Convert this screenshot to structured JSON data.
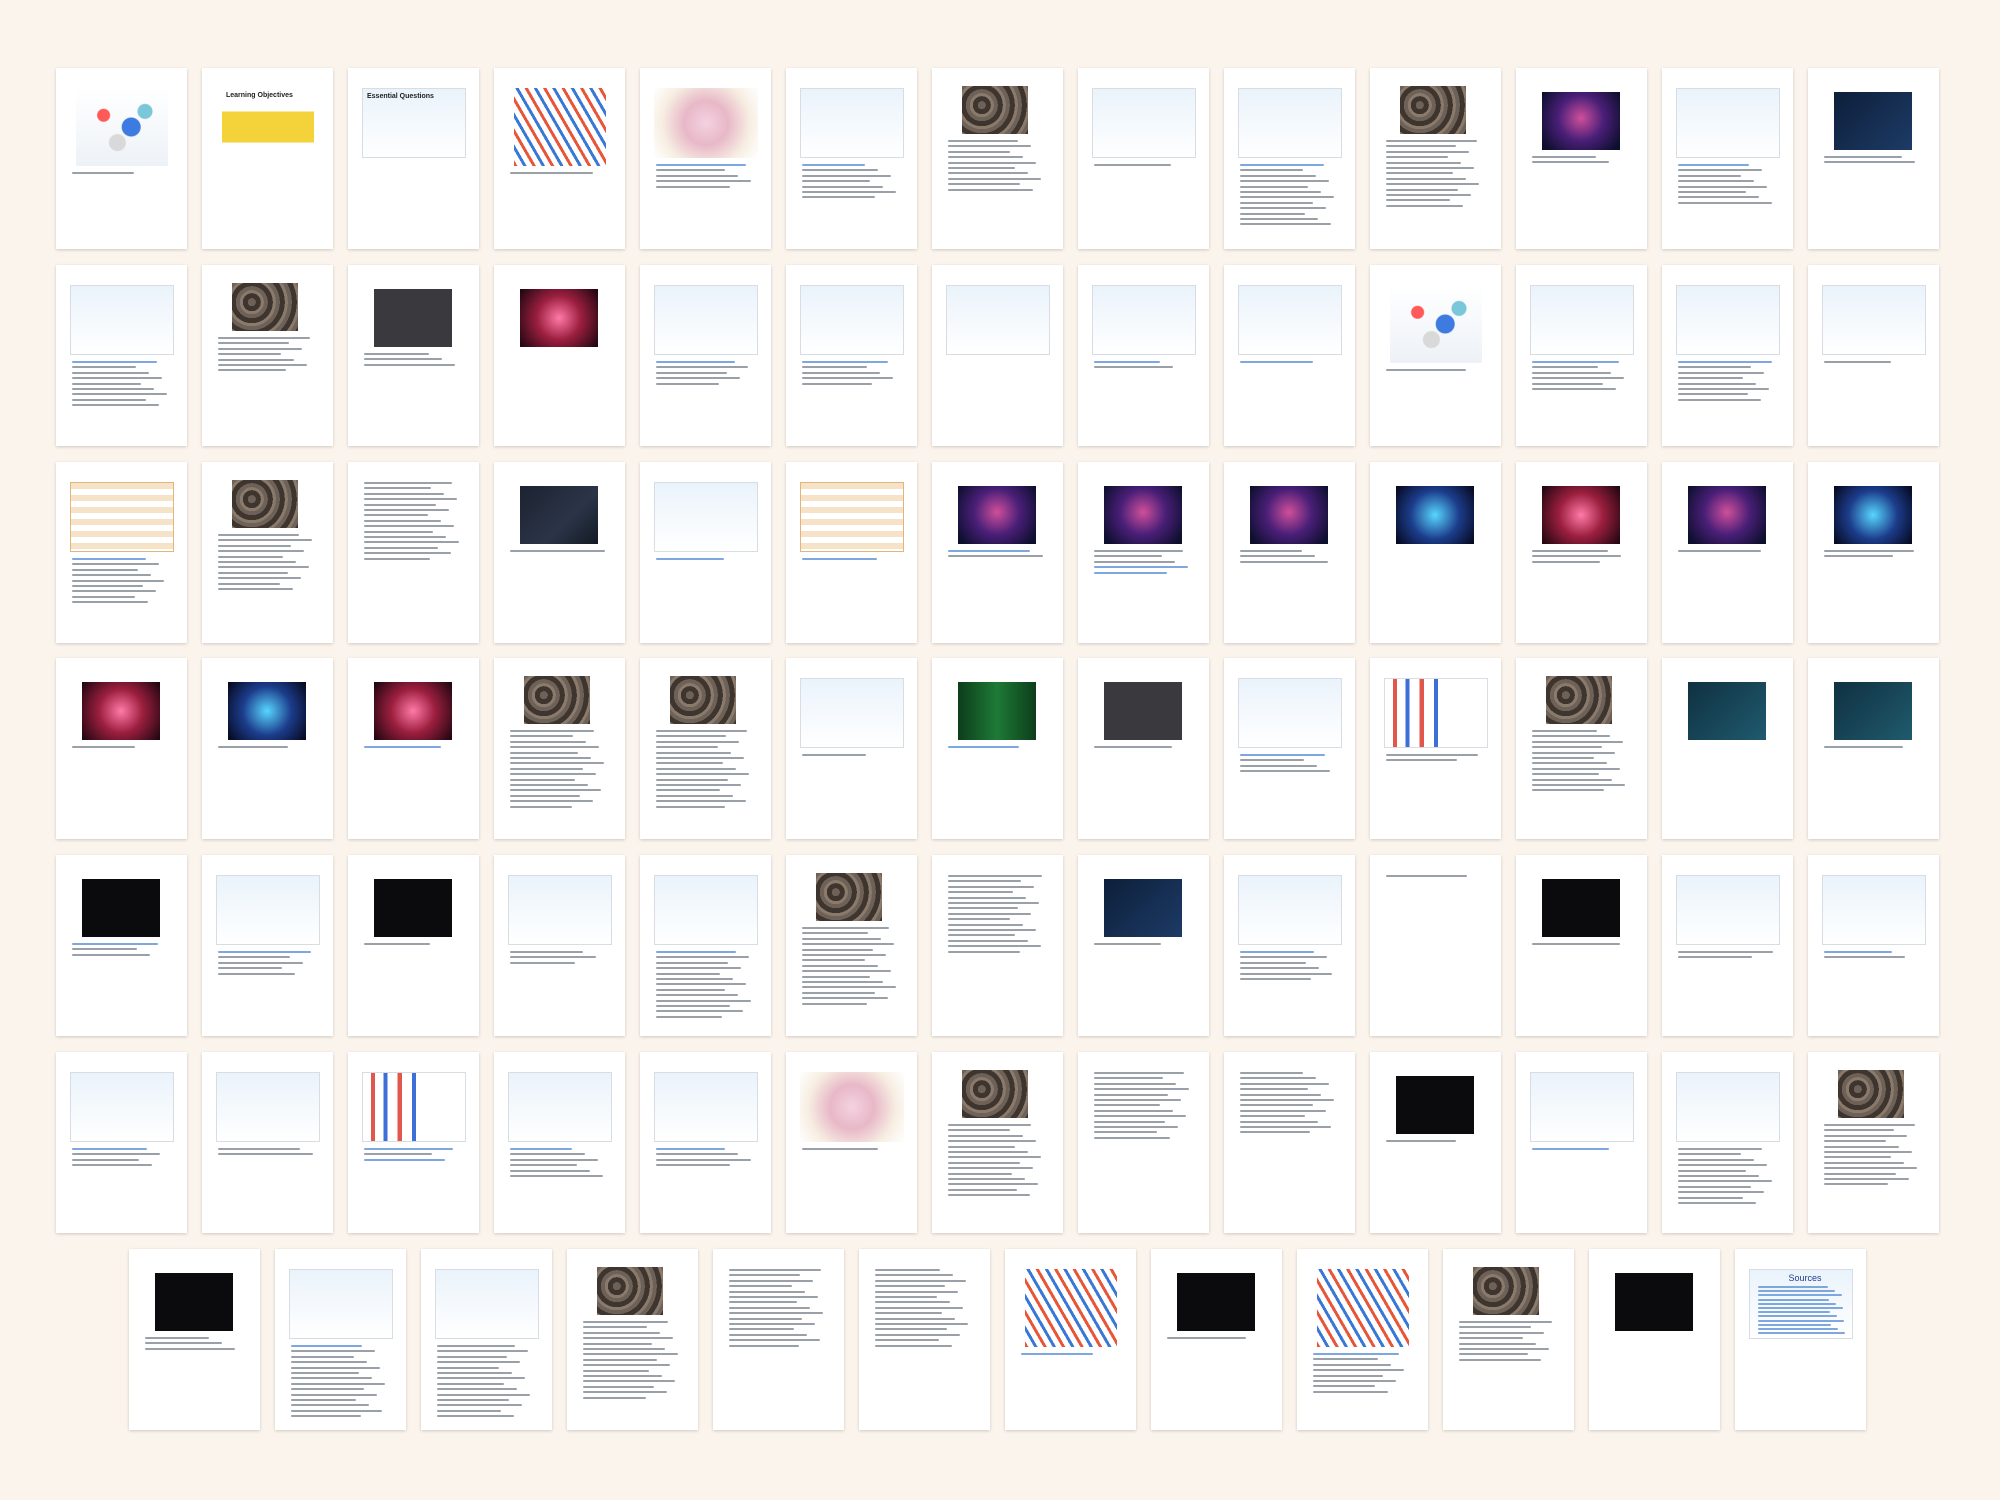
{
  "document": {
    "background_color": "#fbf4ec",
    "pages": [
      {
        "n": 1,
        "kind": "molecule",
        "title": "",
        "lines": [
          "dark"
        ]
      },
      {
        "n": 2,
        "kind": "yellow",
        "title": "Learning Objectives",
        "lines": []
      },
      {
        "n": 3,
        "kind": "light",
        "title": "Essential Questions",
        "lines": []
      },
      {
        "n": 4,
        "kind": "helix",
        "title": "",
        "lines": [
          "dark"
        ]
      },
      {
        "n": 5,
        "kind": "pink",
        "title": "",
        "lines": [
          "blue",
          "dark",
          "dark",
          "dark",
          "dark"
        ]
      },
      {
        "n": 6,
        "kind": "light",
        "title": "",
        "lines": [
          "blue",
          "dark",
          "dark",
          "dark",
          "dark",
          "dark",
          "dark"
        ]
      },
      {
        "n": 7,
        "kind": "rough",
        "title": "",
        "lines": [
          "dark",
          "dark",
          "dark",
          "dark",
          "dark",
          "dark",
          "dark",
          "dark",
          "dark",
          "dark"
        ]
      },
      {
        "n": 8,
        "kind": "light",
        "title": "",
        "lines": [
          "dark"
        ]
      },
      {
        "n": 9,
        "kind": "light",
        "title": "",
        "lines": [
          "blue",
          "dark",
          "dark",
          "dark",
          "dark",
          "dark",
          "dark",
          "dark",
          "dark",
          "dark",
          "dark",
          "dark"
        ]
      },
      {
        "n": 10,
        "kind": "rough",
        "title": "",
        "lines": [
          "dark",
          "dark",
          "dark",
          "dark",
          "dark",
          "dark",
          "dark",
          "dark",
          "dark",
          "dark",
          "dark",
          "dark",
          "dark"
        ]
      },
      {
        "n": 11,
        "kind": "indigo",
        "title": "",
        "lines": [
          "dark",
          "dark"
        ]
      },
      {
        "n": 12,
        "kind": "light",
        "title": "",
        "lines": [
          "blue",
          "dark",
          "dark",
          "dark",
          "dark",
          "dark",
          "dark",
          "dark"
        ]
      },
      {
        "n": 13,
        "kind": "navy",
        "title": "",
        "lines": [
          "dark",
          "dark"
        ]
      },
      {
        "n": 14,
        "kind": "light",
        "title": "",
        "lines": [
          "blue",
          "dark",
          "dark",
          "dark",
          "dark",
          "dark",
          "dark",
          "dark",
          "dark"
        ]
      },
      {
        "n": 15,
        "kind": "rough",
        "title": "",
        "lines": [
          "dark",
          "dark",
          "dark",
          "dark",
          "dark",
          "dark",
          "dark"
        ]
      },
      {
        "n": 16,
        "kind": "gray",
        "title": "",
        "lines": [
          "dark",
          "dark",
          "dark"
        ]
      },
      {
        "n": 17,
        "kind": "red",
        "title": "",
        "lines": []
      },
      {
        "n": 18,
        "kind": "light",
        "title": "",
        "lines": [
          "blue",
          "dark",
          "dark",
          "dark",
          "dark"
        ]
      },
      {
        "n": 19,
        "kind": "light",
        "title": "",
        "lines": [
          "blue",
          "dark",
          "dark",
          "dark",
          "dark"
        ]
      },
      {
        "n": 20,
        "kind": "light",
        "title": "",
        "lines": []
      },
      {
        "n": 21,
        "kind": "light",
        "title": "",
        "lines": [
          "blue",
          "dark"
        ]
      },
      {
        "n": 22,
        "kind": "light",
        "title": "",
        "lines": [
          "blue"
        ]
      },
      {
        "n": 23,
        "kind": "molecule",
        "title": "",
        "lines": [
          "dark"
        ]
      },
      {
        "n": 24,
        "kind": "light",
        "title": "",
        "lines": [
          "blue",
          "dark",
          "dark",
          "dark",
          "dark",
          "dark"
        ]
      },
      {
        "n": 25,
        "kind": "light",
        "title": "",
        "lines": [
          "blue",
          "dark",
          "dark",
          "dark",
          "dark",
          "dark",
          "dark",
          "dark"
        ]
      },
      {
        "n": 26,
        "kind": "light",
        "title": "",
        "lines": [
          "dark"
        ]
      },
      {
        "n": 27,
        "kind": "table",
        "title": "",
        "lines": [
          "blue",
          "dark",
          "dark",
          "dark",
          "dark",
          "dark",
          "dark",
          "dark",
          "dark"
        ]
      },
      {
        "n": 28,
        "kind": "rough",
        "title": "",
        "lines": [
          "dark",
          "dark",
          "dark",
          "dark",
          "dark",
          "dark",
          "dark",
          "dark",
          "dark",
          "dark",
          "dark"
        ]
      },
      {
        "n": 29,
        "kind": "none",
        "title": "",
        "lines": [
          "dark",
          "dark",
          "dark",
          "dark",
          "dark",
          "dark",
          "dark",
          "dark",
          "dark",
          "dark",
          "dark",
          "dark",
          "dark",
          "dark",
          "dark"
        ]
      },
      {
        "n": 30,
        "kind": "dark",
        "title": "",
        "lines": [
          "dark"
        ]
      },
      {
        "n": 31,
        "kind": "light",
        "title": "",
        "lines": [
          "blue"
        ]
      },
      {
        "n": 32,
        "kind": "table",
        "title": "",
        "lines": [
          "blue"
        ]
      },
      {
        "n": 33,
        "kind": "indigo",
        "title": "",
        "lines": [
          "blue",
          "dark"
        ]
      },
      {
        "n": 34,
        "kind": "indigo",
        "title": "",
        "lines": [
          "dark",
          "dark",
          "dark",
          "blue",
          "blue"
        ]
      },
      {
        "n": 35,
        "kind": "indigo",
        "title": "",
        "lines": [
          "dark",
          "dark",
          "dark"
        ]
      },
      {
        "n": 36,
        "kind": "cyan",
        "title": "",
        "lines": []
      },
      {
        "n": 37,
        "kind": "red",
        "title": "",
        "lines": [
          "dark",
          "dark",
          "dark"
        ]
      },
      {
        "n": 38,
        "kind": "indigo",
        "title": "",
        "lines": [
          "dark"
        ]
      },
      {
        "n": 39,
        "kind": "cyan",
        "title": "",
        "lines": [
          "dark",
          "dark"
        ]
      },
      {
        "n": 40,
        "kind": "red",
        "title": "",
        "lines": [
          "dark"
        ]
      },
      {
        "n": 41,
        "kind": "cyan",
        "title": "",
        "lines": [
          "dark"
        ]
      },
      {
        "n": 42,
        "kind": "red",
        "title": "",
        "lines": [
          "blue"
        ]
      },
      {
        "n": 43,
        "kind": "rough",
        "title": "",
        "lines": [
          "dark",
          "dark",
          "dark",
          "dark",
          "dark",
          "dark",
          "dark",
          "dark",
          "dark",
          "dark",
          "dark",
          "dark",
          "dark",
          "dark",
          "dark"
        ]
      },
      {
        "n": 44,
        "kind": "rough",
        "title": "",
        "lines": [
          "dark",
          "dark",
          "dark",
          "dark",
          "dark",
          "dark",
          "dark",
          "dark",
          "dark",
          "dark",
          "dark",
          "dark",
          "dark",
          "dark",
          "dark"
        ]
      },
      {
        "n": 45,
        "kind": "light",
        "title": "",
        "lines": [
          "dark"
        ]
      },
      {
        "n": 46,
        "kind": "green",
        "title": "",
        "lines": [
          "blue"
        ]
      },
      {
        "n": 47,
        "kind": "gray",
        "title": "",
        "lines": [
          "dark"
        ]
      },
      {
        "n": 48,
        "kind": "light",
        "title": "",
        "lines": [
          "blue",
          "dark",
          "dark",
          "dark"
        ]
      },
      {
        "n": 49,
        "kind": "chart",
        "title": "",
        "lines": [
          "dark",
          "dark"
        ]
      },
      {
        "n": 50,
        "kind": "rough",
        "title": "",
        "lines": [
          "dark",
          "dark",
          "dark",
          "dark",
          "dark",
          "dark",
          "dark",
          "dark",
          "dark",
          "dark",
          "dark",
          "dark"
        ]
      },
      {
        "n": 51,
        "kind": "teal",
        "title": "",
        "lines": []
      },
      {
        "n": 52,
        "kind": "teal",
        "title": "",
        "lines": [
          "dark"
        ]
      },
      {
        "n": 53,
        "kind": "black",
        "title": "",
        "lines": [
          "blue",
          "dark",
          "dark"
        ]
      },
      {
        "n": 54,
        "kind": "light",
        "title": "",
        "lines": [
          "blue",
          "dark",
          "dark",
          "dark",
          "dark"
        ]
      },
      {
        "n": 55,
        "kind": "black",
        "title": "",
        "lines": [
          "dark"
        ]
      },
      {
        "n": 56,
        "kind": "light",
        "title": "",
        "lines": [
          "dark",
          "dark",
          "dark"
        ]
      },
      {
        "n": 57,
        "kind": "light",
        "title": "",
        "lines": [
          "blue",
          "dark",
          "dark",
          "dark",
          "dark",
          "dark",
          "dark",
          "dark",
          "dark",
          "dark",
          "dark",
          "dark",
          "dark"
        ]
      },
      {
        "n": 58,
        "kind": "rough",
        "title": "",
        "lines": [
          "dark",
          "dark",
          "dark",
          "dark",
          "dark",
          "dark",
          "dark",
          "dark",
          "dark",
          "dark",
          "dark",
          "dark",
          "dark",
          "dark",
          "dark"
        ]
      },
      {
        "n": 59,
        "kind": "none",
        "title": "",
        "lines": [
          "dark",
          "dark",
          "dark",
          "dark",
          "dark",
          "dark",
          "dark",
          "dark",
          "dark",
          "dark",
          "dark",
          "dark",
          "dark",
          "dark",
          "dark"
        ]
      },
      {
        "n": 60,
        "kind": "navy",
        "title": "",
        "lines": [
          "dark"
        ]
      },
      {
        "n": 61,
        "kind": "light",
        "title": "",
        "lines": [
          "blue",
          "dark",
          "dark",
          "dark",
          "dark",
          "dark"
        ]
      },
      {
        "n": 62,
        "kind": "none",
        "title": "",
        "lines": [
          "dark"
        ]
      },
      {
        "n": 63,
        "kind": "black",
        "title": "",
        "lines": [
          "dark"
        ]
      },
      {
        "n": 64,
        "kind": "light",
        "title": "",
        "lines": [
          "dark",
          "dark"
        ]
      },
      {
        "n": 65,
        "kind": "light",
        "title": "",
        "lines": [
          "blue",
          "dark"
        ]
      },
      {
        "n": 66,
        "kind": "light",
        "title": "",
        "lines": [
          "blue",
          "dark",
          "dark",
          "dark"
        ]
      },
      {
        "n": 67,
        "kind": "light",
        "title": "",
        "lines": [
          "dark",
          "dark"
        ]
      },
      {
        "n": 68,
        "kind": "chart",
        "title": "",
        "lines": [
          "blue",
          "dark",
          "blue"
        ]
      },
      {
        "n": 69,
        "kind": "light",
        "title": "",
        "lines": [
          "blue",
          "dark",
          "dark",
          "dark",
          "dark",
          "dark"
        ]
      },
      {
        "n": 70,
        "kind": "light",
        "title": "",
        "lines": [
          "blue",
          "dark",
          "dark",
          "dark"
        ]
      },
      {
        "n": 71,
        "kind": "pink",
        "title": "",
        "lines": [
          "dark"
        ]
      },
      {
        "n": 72,
        "kind": "rough",
        "title": "",
        "lines": [
          "dark",
          "dark",
          "dark",
          "dark",
          "dark",
          "dark",
          "dark",
          "dark",
          "dark",
          "dark",
          "dark",
          "dark",
          "dark",
          "dark"
        ]
      },
      {
        "n": 73,
        "kind": "none",
        "title": "",
        "lines": [
          "dark",
          "dark",
          "dark",
          "dark",
          "dark",
          "dark",
          "dark",
          "dark",
          "dark",
          "dark",
          "dark",
          "dark",
          "dark"
        ]
      },
      {
        "n": 74,
        "kind": "none",
        "title": "",
        "lines": [
          "dark",
          "dark",
          "dark",
          "dark",
          "dark",
          "dark",
          "dark",
          "dark",
          "dark",
          "dark",
          "dark",
          "dark"
        ]
      },
      {
        "n": 75,
        "kind": "black",
        "title": "",
        "lines": [
          "dark"
        ]
      },
      {
        "n": 76,
        "kind": "light",
        "title": "",
        "lines": [
          "blue"
        ]
      },
      {
        "n": 77,
        "kind": "light",
        "title": "",
        "lines": [
          "dark",
          "dark",
          "dark",
          "dark",
          "dark",
          "dark",
          "dark",
          "dark",
          "dark",
          "dark",
          "dark"
        ]
      },
      {
        "n": 78,
        "kind": "rough",
        "title": "",
        "lines": [
          "dark",
          "dark",
          "dark",
          "dark",
          "dark",
          "dark",
          "dark",
          "dark",
          "dark",
          "dark",
          "dark",
          "dark"
        ]
      },
      {
        "n": 79,
        "kind": "black",
        "title": "",
        "lines": [
          "dark",
          "dark",
          "dark"
        ]
      },
      {
        "n": 80,
        "kind": "light",
        "title": "",
        "lines": [
          "blue",
          "dark",
          "dark",
          "dark",
          "dark",
          "dark",
          "dark",
          "dark",
          "dark",
          "dark",
          "dark",
          "dark",
          "dark",
          "dark"
        ]
      },
      {
        "n": 81,
        "kind": "light",
        "title": "",
        "lines": [
          "dark",
          "dark",
          "dark",
          "dark",
          "dark",
          "dark",
          "dark",
          "dark",
          "dark",
          "dark",
          "dark",
          "dark",
          "dark",
          "dark",
          "dark"
        ]
      },
      {
        "n": 82,
        "kind": "rough",
        "title": "",
        "lines": [
          "dark",
          "dark",
          "dark",
          "dark",
          "dark",
          "dark",
          "dark",
          "dark",
          "dark",
          "dark",
          "dark",
          "dark",
          "dark",
          "dark",
          "dark"
        ]
      },
      {
        "n": 83,
        "kind": "none",
        "title": "",
        "lines": [
          "dark",
          "dark",
          "dark",
          "dark",
          "dark",
          "dark",
          "dark",
          "dark",
          "dark",
          "dark",
          "dark",
          "dark",
          "dark",
          "dark",
          "dark"
        ]
      },
      {
        "n": 84,
        "kind": "none",
        "title": "",
        "lines": [
          "dark",
          "dark",
          "dark",
          "dark",
          "dark",
          "dark",
          "dark",
          "dark",
          "dark",
          "dark",
          "dark",
          "dark",
          "dark",
          "dark",
          "dark"
        ]
      },
      {
        "n": 85,
        "kind": "helix",
        "title": "",
        "lines": [
          "blue"
        ]
      },
      {
        "n": 86,
        "kind": "black",
        "title": "",
        "lines": [
          "dark"
        ]
      },
      {
        "n": 87,
        "kind": "helix",
        "title": "",
        "lines": [
          "blue",
          "dark",
          "dark",
          "dark",
          "dark",
          "dark",
          "dark",
          "dark"
        ]
      },
      {
        "n": 88,
        "kind": "rough",
        "title": "",
        "lines": [
          "dark",
          "dark",
          "dark",
          "dark",
          "dark",
          "dark",
          "dark",
          "dark"
        ]
      },
      {
        "n": 89,
        "kind": "black",
        "title": "",
        "lines": []
      },
      {
        "n": 90,
        "kind": "sources",
        "title": "Sources",
        "lines": []
      }
    ]
  }
}
